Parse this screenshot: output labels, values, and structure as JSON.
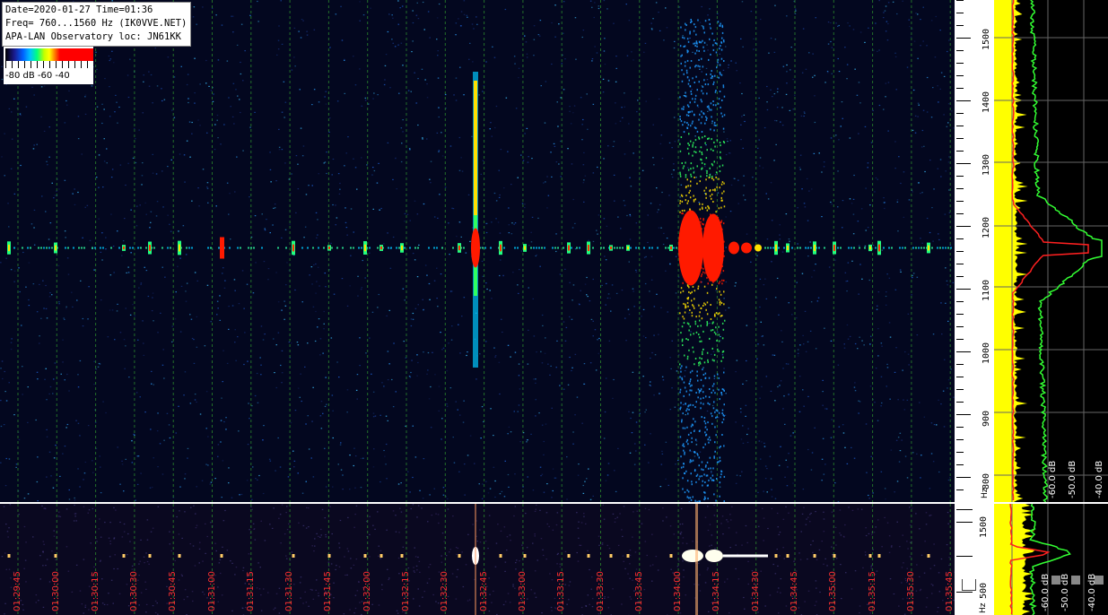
{
  "info": {
    "line1": "Date=2020-01-27 Time=01:36",
    "line2": "Freq= 760...1560 Hz (IK0VVE.NET)",
    "line3": "APA-LAN Observatory loc: JN61KK"
  },
  "scale": {
    "labels": "-80 dB -60     -40"
  },
  "freq_axis": {
    "labels": [
      "1500",
      "1400",
      "1300",
      "1200",
      "1100",
      "1000",
      "900",
      "800"
    ],
    "unit": "Hz"
  },
  "freq_axis_lower": {
    "labels": [
      "1500",
      "500"
    ],
    "unit": "Hz"
  },
  "time_axis": {
    "labels": [
      "01:29:45",
      "01:30:00",
      "01:30:15",
      "01:30:30",
      "01:30:45",
      "01:31:00",
      "01:31:15",
      "01:31:30",
      "01:31:45",
      "01:32:00",
      "01:32:15",
      "01:32:30",
      "01:32:45",
      "01:33:00",
      "01:33:15",
      "01:33:30",
      "01:33:45",
      "01:34:00",
      "01:34:15",
      "01:34:30",
      "01:34:45",
      "01:35:00",
      "01:35:15",
      "01:35:30",
      "01:35:45"
    ]
  },
  "spectrum_labels": {
    "db_top": [
      "-60.0 dB",
      "-50.0 dB",
      "-40.0 dB"
    ],
    "db_bottom": [
      "-60.0 dB",
      "-50.0 dB",
      "-40.0 dB"
    ]
  },
  "colors": {
    "background": "#03071f",
    "grid": "#2c8a2c",
    "signal_hot": "#ff0000",
    "spectrum_avg": "#ffff00",
    "spectrum_peak": "#33ff33",
    "spectrum_line": "#ff2020",
    "time_label": "#ff3030"
  }
}
